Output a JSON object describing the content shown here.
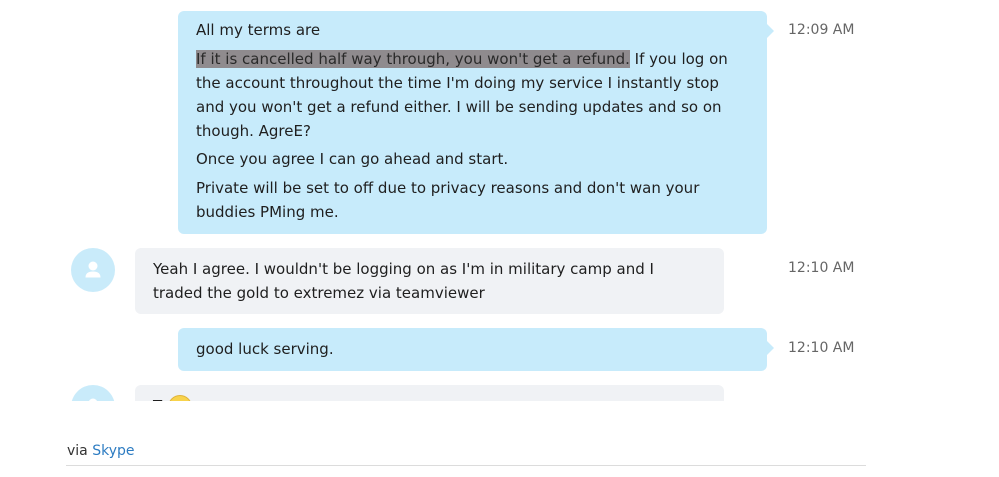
{
  "messages": [
    {
      "direction": "out",
      "time": "12:09 AM",
      "lines": {
        "l1": "All my terms are",
        "l2_highlight": "If it is cancelled half way through, you won't get a refund.",
        "l2_rest": " If you log on the account throughout the time I'm doing my service I instantly stop and you won't get a refund either. I will be sending updates and so on though. AgreE?",
        "l3": "Once you agree I can go ahead and start.",
        "l4": "Private will be set to off due to privacy reasons and don't wan your buddies PMing me."
      }
    },
    {
      "direction": "in",
      "time": "12:10 AM",
      "text": "Yeah I agree. I wouldn't be logging on as I'm in military camp and I traded the gold to extremez via teamviewer"
    },
    {
      "direction": "out",
      "time": "12:10 AM",
      "text": "good luck serving."
    },
    {
      "direction": "in",
      "text": "T"
    }
  ],
  "footer": {
    "via": "via",
    "link": "Skype"
  },
  "colors": {
    "outgoing_bubble": "#c7ebfb",
    "incoming_bubble": "#f0f2f5",
    "highlight": "#8f8b8e",
    "link": "#2d7cc2",
    "avatar": "#c9ebfa"
  }
}
